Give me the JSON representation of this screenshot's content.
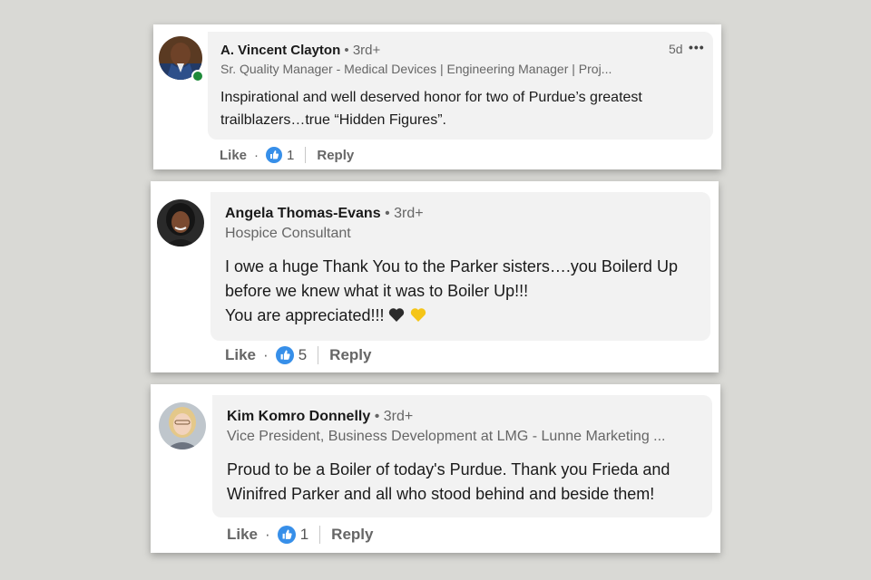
{
  "comments": [
    {
      "author": "A. Vincent Clayton",
      "degree": "• 3rd+",
      "headline": "Sr. Quality Manager - Medical Devices | Engineering Manager | Proj...",
      "time": "5d",
      "more": "•••",
      "body": [
        "Inspirational and well deserved honor for two of Purdue’s greatest",
        "trailblazers…true “Hidden Figures”."
      ],
      "like_label": "Like",
      "reaction_count": "1",
      "reply_label": "Reply",
      "online": true
    },
    {
      "author": "Angela Thomas-Evans",
      "degree": "• 3rd+",
      "headline": "Hospice Consultant",
      "body": [
        "I owe a huge Thank You to the Parker sisters….you Boilerd Up",
        "before we knew what it was to Boiler Up!!!",
        "You are appreciated!!!"
      ],
      "emoji_icons": [
        "black-heart-icon",
        "yellow-heart-icon"
      ],
      "like_label": "Like",
      "reaction_count": "5",
      "reply_label": "Reply"
    },
    {
      "author": "Kim Komro Donnelly",
      "degree": "• 3rd+",
      "headline": "Vice President, Business Development at LMG - Lunne Marketing ...",
      "body": [
        "Proud to be a Boiler of today's Purdue. Thank you Frieda and",
        "Winifred Parker and all who stood behind and beside them!"
      ],
      "like_label": "Like",
      "reaction_count": "1",
      "reply_label": "Reply"
    }
  ],
  "colors": {
    "background": "#d9d9d5",
    "bubble": "#f2f2f2",
    "like_blue": "#378fe9",
    "online_green": "#1e8a3a"
  }
}
